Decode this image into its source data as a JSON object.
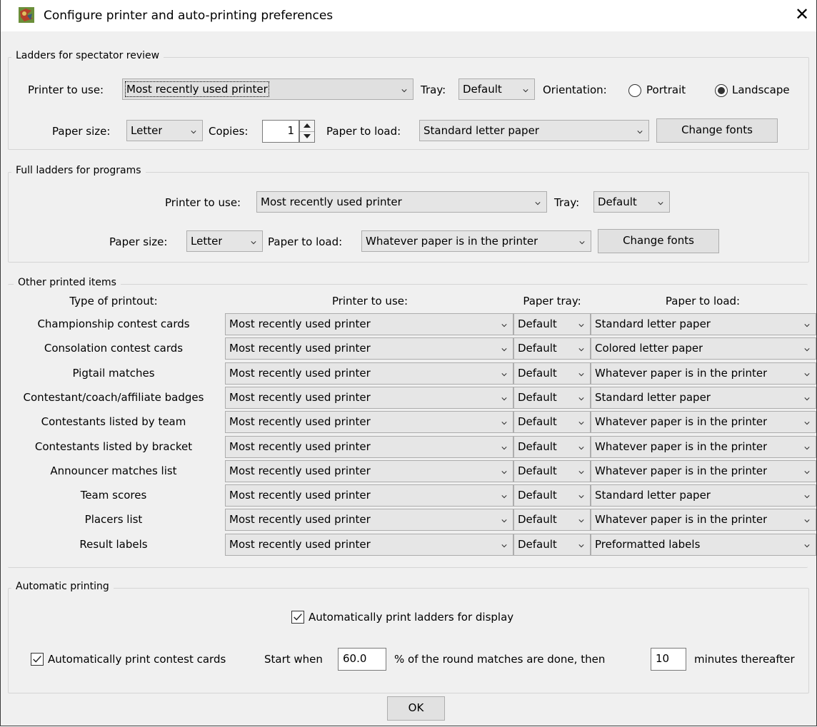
{
  "window": {
    "title": "Configure printer and auto-printing preferences"
  },
  "ladders_spectator": {
    "legend": "Ladders for spectator review",
    "printer_label": "Printer to use:",
    "printer_value": "Most recently used printer",
    "tray_label": "Tray:",
    "tray_value": "Default",
    "orientation_label": "Orientation:",
    "portrait_label": "Portrait",
    "landscape_label": "Landscape",
    "orientation_selected": "Landscape",
    "paper_size_label": "Paper size:",
    "paper_size_value": "Letter",
    "copies_label": "Copies:",
    "copies_value": "1",
    "paper_load_label": "Paper to load:",
    "paper_load_value": "Standard letter paper",
    "change_fonts": "Change fonts"
  },
  "full_ladders": {
    "legend": "Full ladders for programs",
    "printer_label": "Printer to use:",
    "printer_value": "Most recently used printer",
    "tray_label": "Tray:",
    "tray_value": "Default",
    "paper_size_label": "Paper size:",
    "paper_size_value": "Letter",
    "paper_load_label": "Paper to load:",
    "paper_load_value": "Whatever paper is in the printer",
    "change_fonts": "Change fonts"
  },
  "other_items": {
    "legend": "Other printed items",
    "headers": {
      "type": "Type of printout:",
      "printer": "Printer to use:",
      "tray": "Paper tray:",
      "paper": "Paper to load:"
    },
    "rows": [
      {
        "type": "Championship contest cards",
        "printer": "Most recently used printer",
        "tray": "Default",
        "paper": "Standard letter paper"
      },
      {
        "type": "Consolation contest cards",
        "printer": "Most recently used printer",
        "tray": "Default",
        "paper": "Colored letter paper"
      },
      {
        "type": "Pigtail matches",
        "printer": "Most recently used printer",
        "tray": "Default",
        "paper": "Whatever paper is in the printer"
      },
      {
        "type": "Contestant/coach/affiliate badges",
        "printer": "Most recently used printer",
        "tray": "Default",
        "paper": "Standard letter paper"
      },
      {
        "type": "Contestants listed by team",
        "printer": "Most recently used printer",
        "tray": "Default",
        "paper": "Whatever paper is in the printer"
      },
      {
        "type": "Contestants listed by bracket",
        "printer": "Most recently used printer",
        "tray": "Default",
        "paper": "Whatever paper is in the printer"
      },
      {
        "type": "Announcer matches list",
        "printer": "Most recently used printer",
        "tray": "Default",
        "paper": "Whatever paper is in the printer"
      },
      {
        "type": "Team scores",
        "printer": "Most recently used printer",
        "tray": "Default",
        "paper": "Standard letter paper"
      },
      {
        "type": "Placers list",
        "printer": "Most recently used printer",
        "tray": "Default",
        "paper": "Whatever paper is in the printer"
      },
      {
        "type": "Result labels",
        "printer": "Most recently used printer",
        "tray": "Default",
        "paper": "Preformatted labels"
      }
    ]
  },
  "auto_printing": {
    "legend": "Automatic printing",
    "ladders_label": "Automatically print ladders for display",
    "ladders_checked": true,
    "cards_label": "Automatically print contest cards",
    "cards_checked": true,
    "start_when_label": "Start when",
    "percent_value": "60.0",
    "percent_suffix": "% of the round matches are done, then",
    "minutes_value": "10",
    "minutes_suffix": "minutes thereafter"
  },
  "ok_button": "OK"
}
